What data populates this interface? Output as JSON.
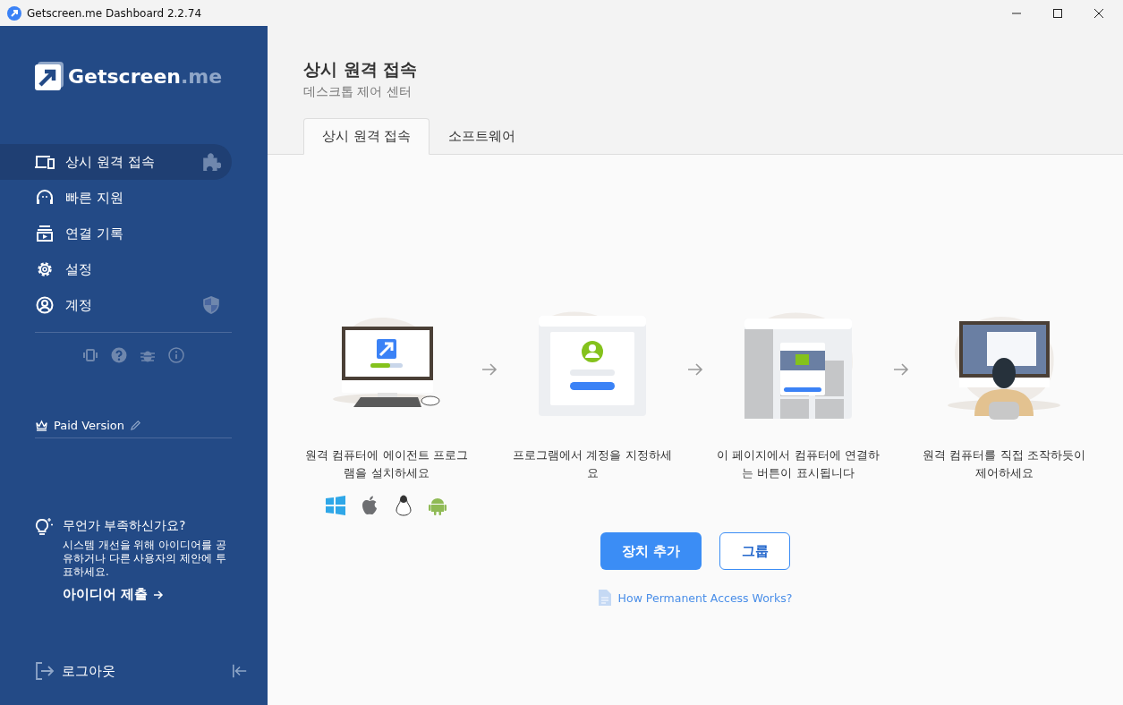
{
  "window": {
    "title": "Getscreen.me Dashboard 2.2.74"
  },
  "sidebar": {
    "logo": {
      "name": "Getscreen",
      "suffix": ".me"
    },
    "nav": [
      {
        "kind": "devices",
        "label": "상시 원격 접속",
        "selected": true
      },
      {
        "kind": "support",
        "label": "빠른 지원",
        "selected": false
      },
      {
        "kind": "history",
        "label": "연결 기록",
        "selected": false
      },
      {
        "kind": "settings",
        "label": "설정",
        "selected": false
      },
      {
        "kind": "account",
        "label": "계정",
        "selected": false
      }
    ],
    "plan": "Paid Version",
    "feedback": {
      "title": "무언가 부족하신가요?",
      "body": "시스템 개선을 위해 아이디어를 공유하거나 다른 사용자의 제안에 투표하세요.",
      "link": "아이디어 제출"
    },
    "logout": "로그아웃"
  },
  "main": {
    "title": "상시 원격 접속",
    "subtitle": "데스크톱 제어 센터",
    "tabs": [
      {
        "label": "상시 원격 접속",
        "selected": true
      },
      {
        "label": "소프트웨어",
        "selected": false
      }
    ],
    "steps": [
      {
        "kind": "install",
        "text": "원격 컴퓨터에 에이전트 프로그램을 설치하세요"
      },
      {
        "kind": "login",
        "text": "프로그램에서 계정을 지정하세요"
      },
      {
        "kind": "connect",
        "text": "이 페이지에서 컴퓨터에 연결하는 버튼이 표시됩니다"
      },
      {
        "kind": "control",
        "text": "원격 컴퓨터를 직접 조작하듯이 제어하세요"
      }
    ],
    "buttons": [
      {
        "kind": "primary",
        "label": "장치 추가"
      },
      {
        "kind": "secondary",
        "label": "그룹"
      }
    ],
    "help_link": "How Permanent Access Works?"
  }
}
